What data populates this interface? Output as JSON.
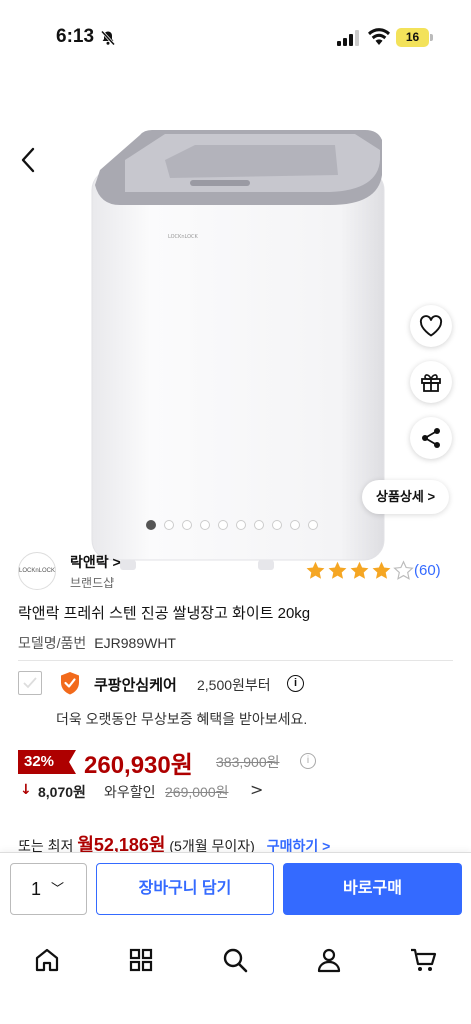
{
  "status_bar": {
    "time": "6:13",
    "battery": "16"
  },
  "hero": {
    "detail_label": "상품상세 >",
    "carousel_count": 10,
    "carousel_active": 0
  },
  "brand": {
    "logo_text": "LOCKnLOCK",
    "name": "락앤락 >",
    "sub": "브랜드샵"
  },
  "rating": {
    "stars": 4,
    "count": "(60)"
  },
  "product": {
    "title": "락앤락 프레쉬 스텐 진공 쌀냉장고 화이트 20kg",
    "model_label": "모델명/품번",
    "model_value": "EJR989WHT"
  },
  "care": {
    "title": "쿠팡안심케어",
    "price": "2,500원부터",
    "info": "i",
    "desc": "더욱 오랫동안 무상보증 혜택을 받아보세요."
  },
  "pricing": {
    "discount": "32%",
    "price": "260,930원",
    "original": "383,900원",
    "wow_arrow": "↓",
    "wow_amount": "8,070원",
    "wow_label": "와우할인",
    "wow_original": "269,000원",
    "chevron": ">"
  },
  "installment": {
    "prefix": "또는 최저",
    "amount": "월52,186원",
    "suffix": "(5개월 무이자)",
    "link": "구매하기 >"
  },
  "actions": {
    "qty": "1",
    "qty_chev": "﹀",
    "cart": "장바구니 담기",
    "buy": "바로구매"
  },
  "colors": {
    "accent": "#346aff",
    "price_red": "#ae0000",
    "star": "#f5a623"
  }
}
